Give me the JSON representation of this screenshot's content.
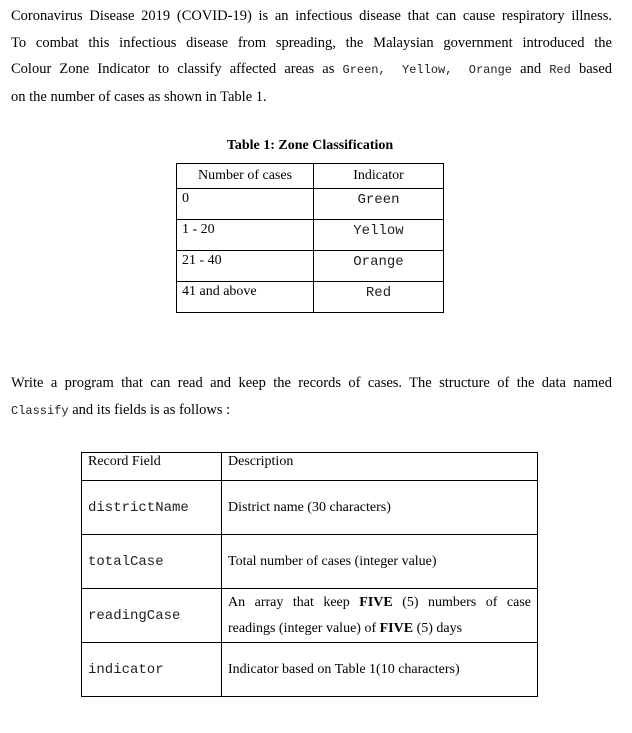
{
  "intro": {
    "line1": "Coronavirus Disease 2019 (COVID-19) is an infectious disease that can cause respiratory illness.",
    "line2": "To combat this infectious disease from spreading, the Malaysian government introduced the",
    "line3_prefix": "Colour Zone Indicator to classify affected areas as ",
    "zones": [
      "Green,",
      "Yellow,",
      "Orange",
      "Red"
    ],
    "and_word": "and",
    "line3_suffix": "based",
    "line4": "on the number of cases as shown in Table 1."
  },
  "table1": {
    "caption": "Table 1: Zone Classification",
    "headers": [
      "Number of cases",
      "Indicator"
    ],
    "rows": [
      {
        "cases": "0",
        "indicator": "Green"
      },
      {
        "cases": "1 - 20",
        "indicator": "Yellow"
      },
      {
        "cases": "21 - 40",
        "indicator": "Orange"
      },
      {
        "cases": "41 and above",
        "indicator": "Red"
      }
    ]
  },
  "task": {
    "line1": "Write a program that can read and keep the records of cases. The structure of the data named",
    "struct_name": "Classify",
    "line2_suffix": " and its fields is as follows :"
  },
  "table2": {
    "headers": [
      "Record Field",
      "Description"
    ],
    "rows": [
      {
        "field": "districtName",
        "description": "District name (30 characters)"
      },
      {
        "field": "totalCase",
        "description": "Total number of cases (integer value)"
      },
      {
        "field": "readingCase",
        "desc_a": "An array that keep ",
        "desc_b": "FIVE",
        "desc_c": " (5) numbers of case",
        "desc_d": "readings (integer value) of ",
        "desc_e": "FIVE",
        "desc_f": " (5) days"
      },
      {
        "field": "indicator",
        "description": "Indicator based on Table 1(10 characters)"
      }
    ]
  }
}
